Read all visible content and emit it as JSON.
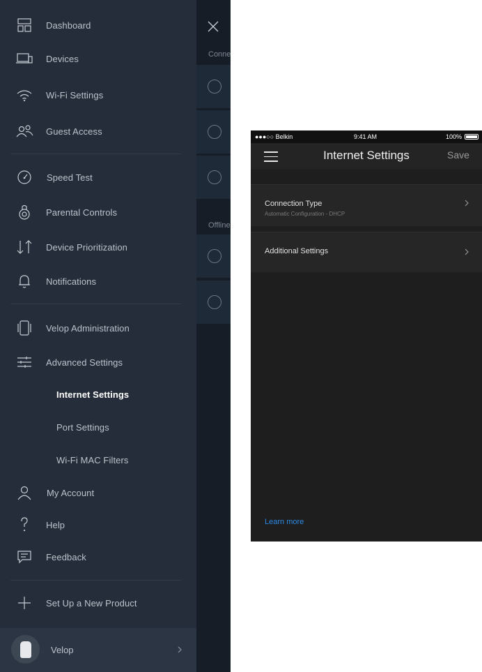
{
  "drawer": {
    "items": [
      {
        "label": "Dashboard",
        "icon": "dashboard-icon"
      },
      {
        "label": "Devices",
        "icon": "devices-icon"
      },
      {
        "label": "Wi-Fi Settings",
        "icon": "wifi-icon"
      },
      {
        "label": "Guest Access",
        "icon": "guest-access-icon"
      },
      {
        "label": "Speed Test",
        "icon": "speed-test-icon"
      },
      {
        "label": "Parental Controls",
        "icon": "parental-controls-icon"
      },
      {
        "label": "Device Prioritization",
        "icon": "prioritization-icon"
      },
      {
        "label": "Notifications",
        "icon": "bell-icon"
      },
      {
        "label": "Velop Administration",
        "icon": "velop-admin-icon"
      },
      {
        "label": "Advanced Settings",
        "icon": "sliders-icon"
      },
      {
        "label": "My Account",
        "icon": "user-icon"
      },
      {
        "label": "Help",
        "icon": "help-icon"
      },
      {
        "label": "Feedback",
        "icon": "feedback-icon"
      },
      {
        "label": "Set Up a New Product",
        "icon": "plus-icon"
      }
    ],
    "sub_items": [
      {
        "label": "Internet Settings",
        "active": true
      },
      {
        "label": "Port Settings",
        "active": false
      },
      {
        "label": "Wi-Fi MAC Filters",
        "active": false
      }
    ],
    "footer": {
      "label": "Velop"
    }
  },
  "background": {
    "groups": [
      "Conne",
      "Offline"
    ]
  },
  "phone": {
    "status": {
      "carrier": "●●●○○ Belkin",
      "time": "9:41 AM",
      "battery": "100%"
    },
    "header": {
      "title": "Internet Settings",
      "save": "Save"
    },
    "rows": [
      {
        "title": "Connection Type",
        "subtitle": "Automatic Configuration - DHCP"
      },
      {
        "title": "Additional Settings"
      }
    ],
    "learn_more": "Learn more"
  },
  "colors": {
    "drawer_bg": "#242d39",
    "link": "#2d8be6"
  }
}
